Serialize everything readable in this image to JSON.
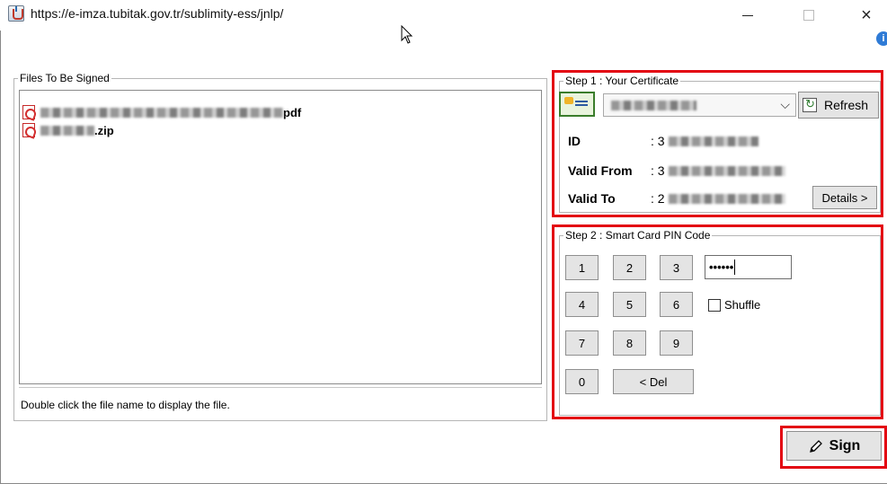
{
  "window": {
    "title": "https://e-imza.tubitak.gov.tr/sublimity-ess/jnlp/",
    "close_glyph": "×"
  },
  "info_glyph": "i",
  "files_panel": {
    "legend": "Files To Be Signed",
    "files": [
      {
        "name_suffix": "pdf",
        "icon": "pdf-icon"
      },
      {
        "name_suffix": ".zip",
        "icon": "pdf-icon"
      }
    ],
    "hint": "Double click the file name to display the file."
  },
  "step1": {
    "legend": "Step 1 : Your Certificate",
    "refresh_label": "Refresh",
    "details_label": "Details >",
    "id_label": "ID",
    "id_value_prefix": ": 3",
    "valid_from_label": "Valid From",
    "valid_from_prefix": ": 3",
    "valid_to_label": "Valid To",
    "valid_to_prefix": ": 2",
    "select_arrow": "⌵"
  },
  "step2": {
    "legend": "Step 2 : Smart Card PIN Code",
    "keys": [
      "1",
      "2",
      "3",
      "4",
      "5",
      "6",
      "7",
      "8",
      "9",
      "0"
    ],
    "del_label": "< Del",
    "pin_masked": "••••••",
    "shuffle_label": "Shuffle",
    "shuffle_checked": false
  },
  "sign_label": "Sign",
  "highlight_color": "#e30613"
}
